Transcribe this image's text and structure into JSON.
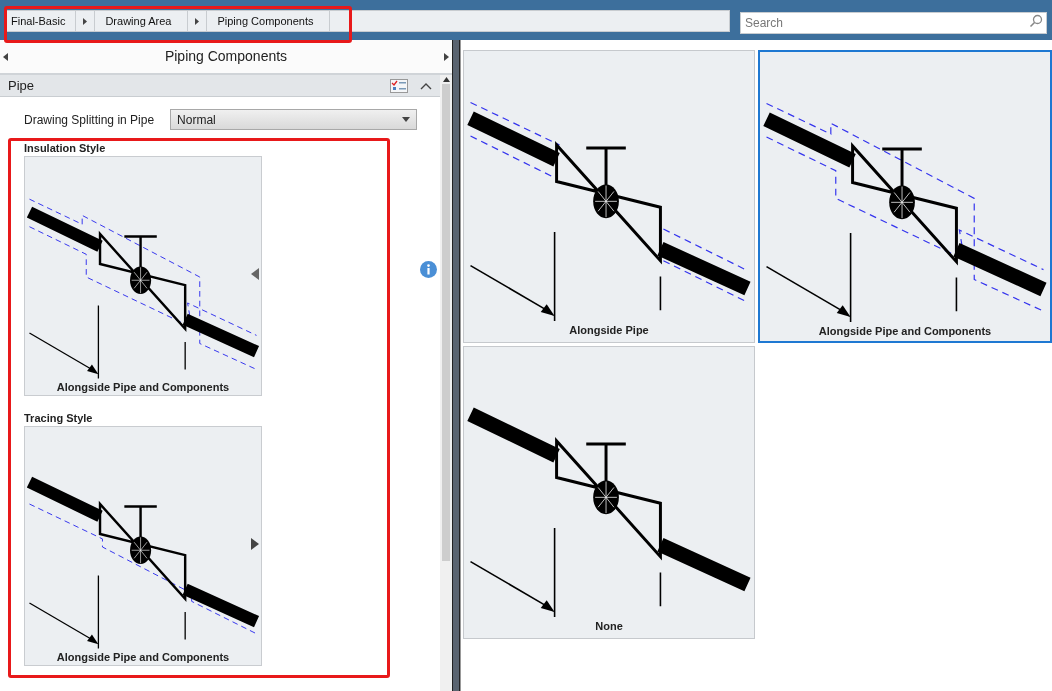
{
  "breadcrumb": [
    {
      "label": "Final-Basic"
    },
    {
      "label": "Drawing Area"
    },
    {
      "label": "Piping Components"
    }
  ],
  "search": {
    "placeholder": "Search"
  },
  "panel": {
    "title": "Piping Components",
    "section": {
      "title": "Pipe",
      "expanded": true
    },
    "field": {
      "label": "Drawing Splitting in Pipe",
      "value": "Normal"
    },
    "styles": [
      {
        "label": "Insulation Style",
        "option": "Alongside Pipe and Components",
        "kind": "insulation"
      },
      {
        "label": "Tracing Style",
        "option": "Alongside Pipe and Components",
        "kind": "tracing"
      }
    ]
  },
  "options": [
    {
      "label": "Alongside Pipe",
      "kind": "pipe",
      "selected": false
    },
    {
      "label": "Alongside Pipe and Components",
      "kind": "components",
      "selected": true
    },
    {
      "label": "None",
      "kind": "none",
      "selected": false
    }
  ]
}
